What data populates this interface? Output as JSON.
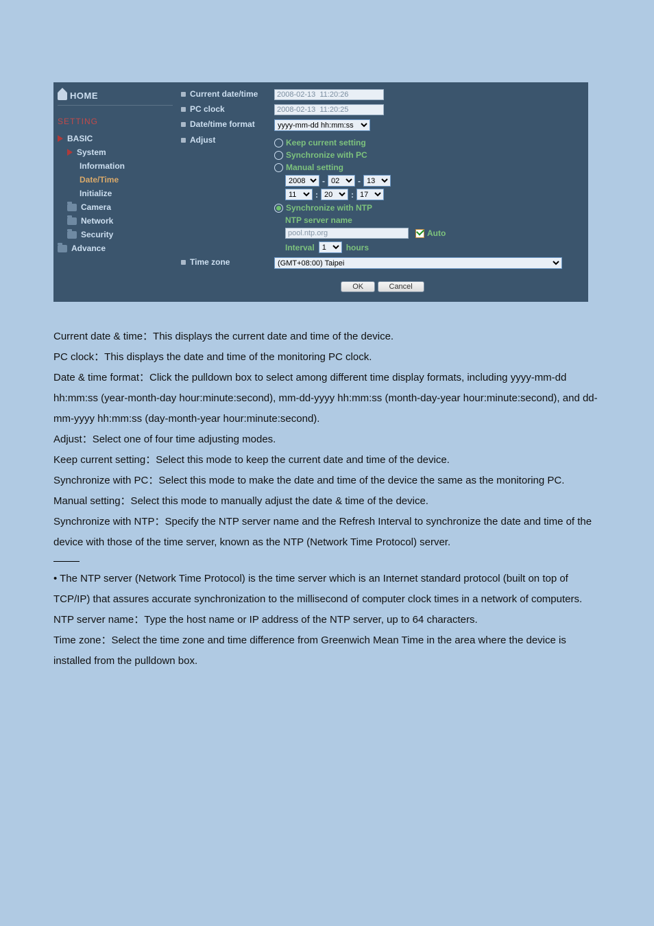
{
  "sidebar": {
    "home": "HOME",
    "setting": "SETTING",
    "basic": "BASIC",
    "system": "System",
    "information": "Information",
    "date_time": "Date/Time",
    "initialize": "Initialize",
    "camera": "Camera",
    "network": "Network",
    "security": "Security",
    "advance": "Advance"
  },
  "panel": {
    "current_label": "Current date/time",
    "current_value": "2008-02-13  11:20:26",
    "pc_clock_label": "PC clock",
    "pc_clock_value": "2008-02-13  11:20:25",
    "fmt_label": "Date/time format",
    "fmt_value": "yyyy-mm-dd hh:mm:ss",
    "adjust_label": "Adjust",
    "keep": "Keep current setting",
    "sync_pc": "Synchronize with PC",
    "manual": "Manual setting",
    "date_y": "2008",
    "date_m": "02",
    "date_d": "13",
    "time_h": "11",
    "time_m": "20",
    "time_s": "17",
    "sync_ntp": "Synchronize with NTP",
    "ntp_name_label": "NTP server name",
    "ntp_name_value": "pool.ntp.org",
    "auto": "Auto",
    "interval_label": "Interval",
    "interval_value": "1",
    "interval_unit": "hours",
    "tz_label": "Time zone",
    "tz_value": "(GMT+08:00) Taipei",
    "ok": "OK",
    "cancel": "Cancel"
  },
  "doc": {
    "p1": "Current date & time：This displays the current date and time of the device.",
    "p2": "PC clock：This displays the date and time of the monitoring PC clock.",
    "p3": "Date & time format：Click the pulldown box to select among different time display formats, including yyyy-mm-dd hh:mm:ss (year-month-day hour:minute:second), mm-dd-yyyy hh:mm:ss (month-day-year hour:minute:second), and dd-mm-yyyy hh:mm:ss (day-month-year hour:minute:second).",
    "p4": "Adjust：Select one of four time adjusting modes.",
    "p5": "Keep current setting：Select this mode to keep the current date and time of the device.",
    "p6": "Synchronize with PC：Select this mode to make the date and time of the device the same as the monitoring PC.",
    "p7": "Manual setting：Select this mode to manually adjust the date & time of the device.",
    "p8": "Synchronize with NTP：Specify the NTP server name and the Refresh Interval to synchronize the date and time of the device with those of the time server, known as the NTP (Network Time Protocol) server.",
    "n1": "• The NTP server (Network Time Protocol) is the time server which is an Internet standard protocol (built on top of TCP/IP) that assures accurate synchronization to the millisecond of computer clock times in a network of computers.",
    "n2": "NTP server name：Type the host name or IP address of the NTP server, up to 64 characters.",
    "n3": "Time zone：Select the time zone and time difference from Greenwich Mean Time in the area where the device is installed from the pulldown box."
  }
}
